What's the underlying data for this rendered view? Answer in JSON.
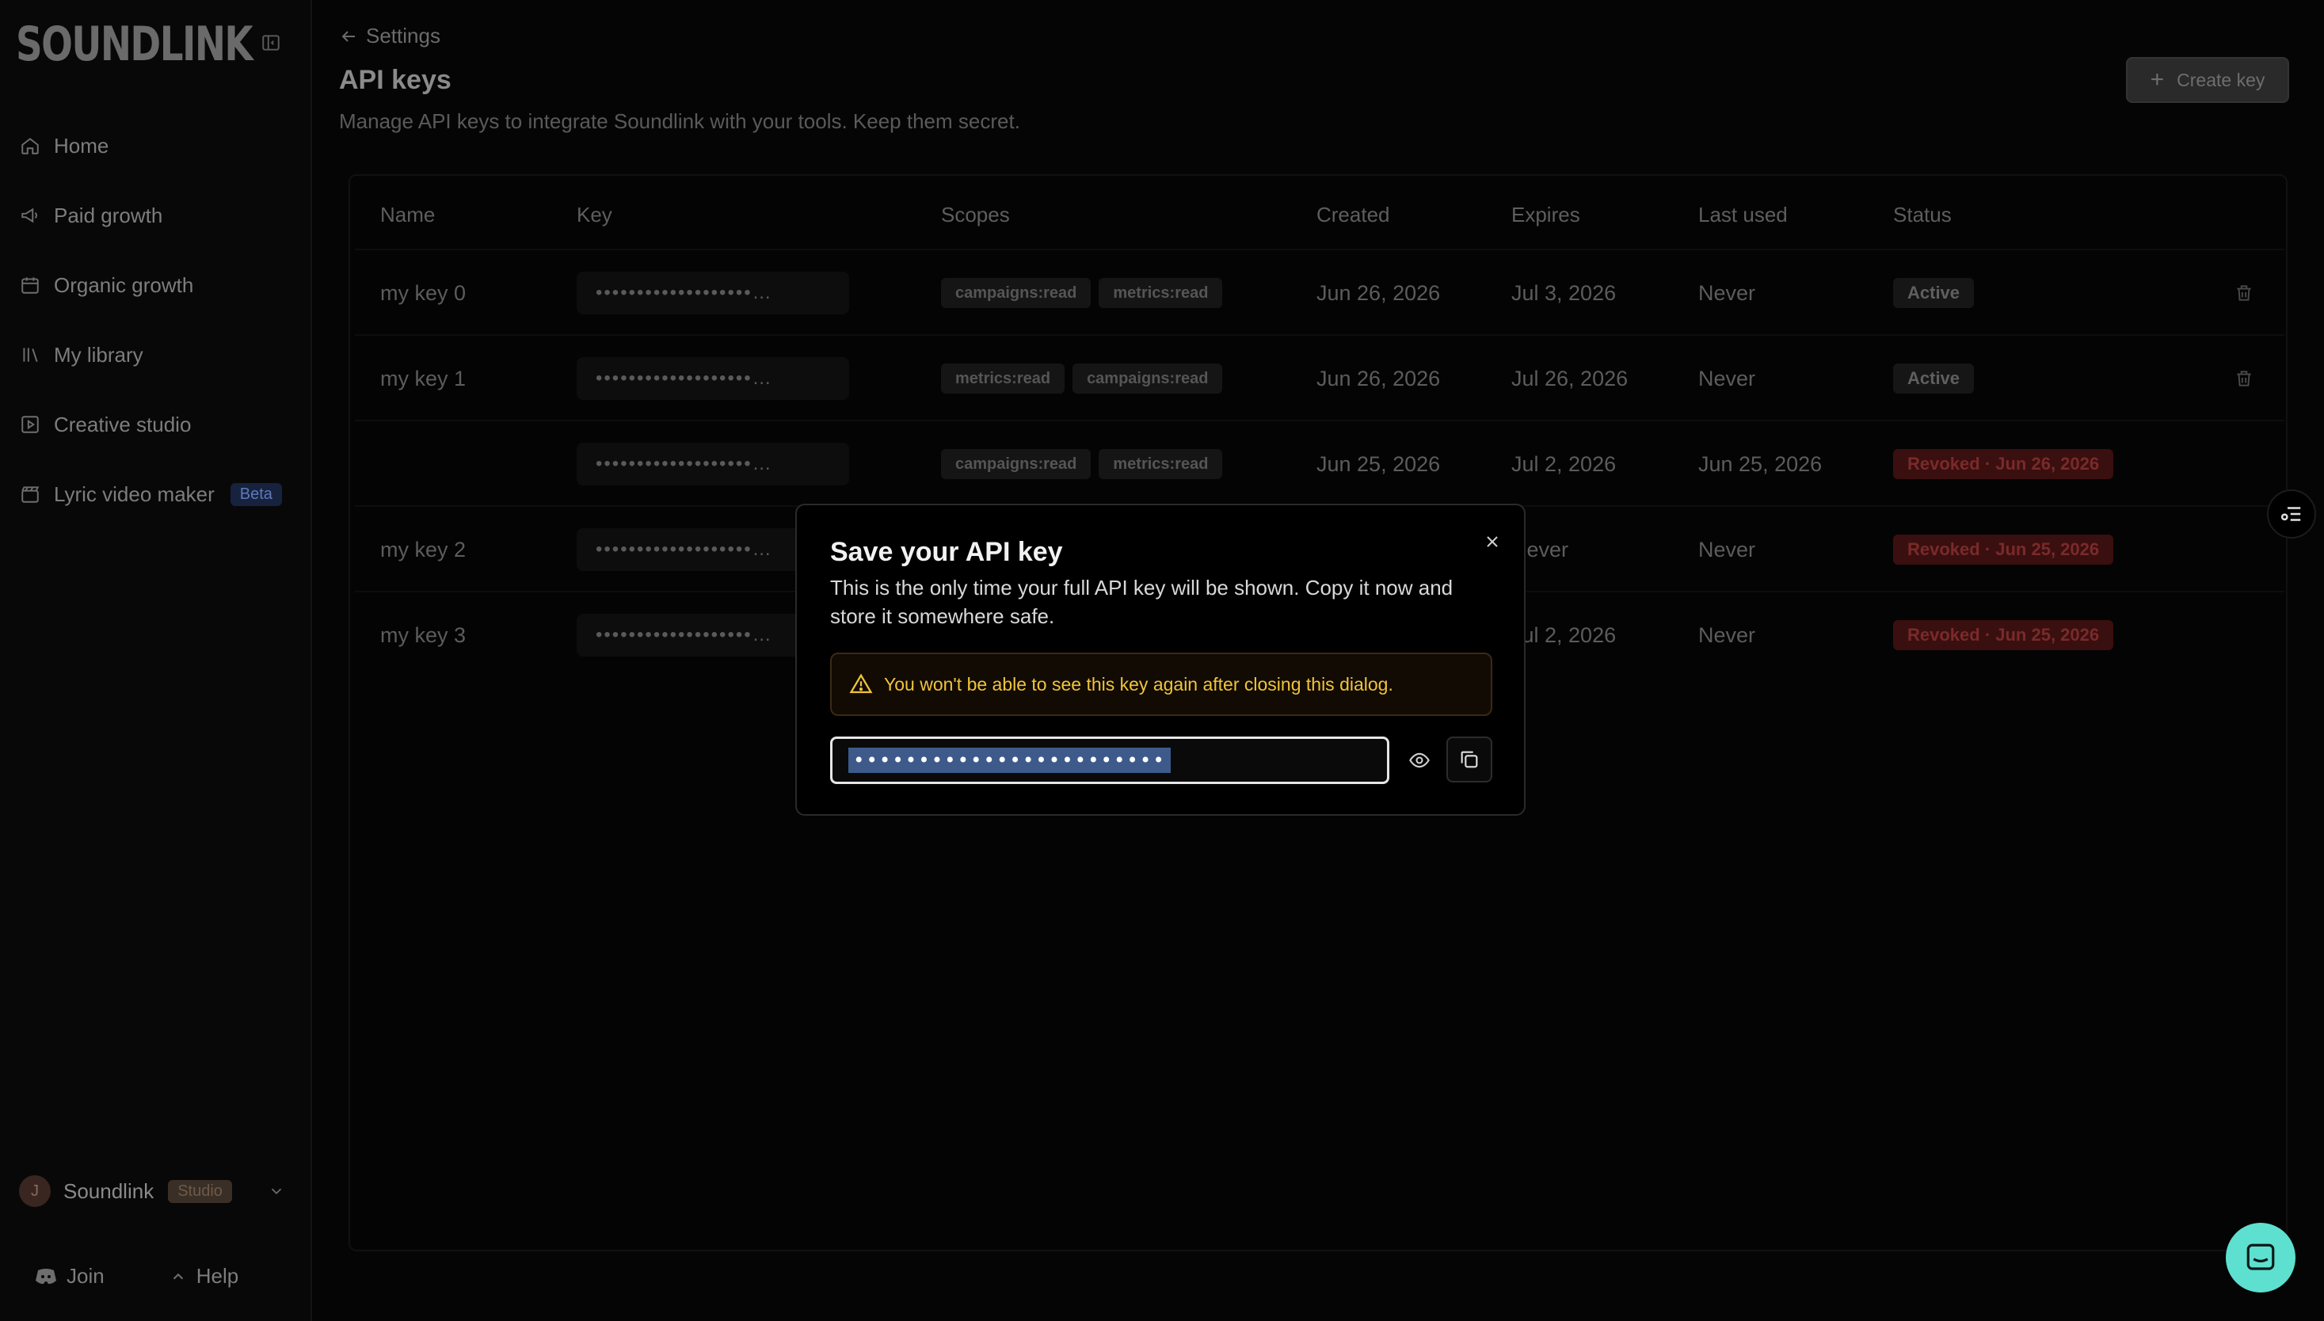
{
  "app": {
    "logo": "SOUNDLINK"
  },
  "sidebar": {
    "items": [
      {
        "label": "Home",
        "icon": "home-icon"
      },
      {
        "label": "Paid growth",
        "icon": "megaphone-icon"
      },
      {
        "label": "Organic growth",
        "icon": "calendar-icon"
      },
      {
        "label": "My library",
        "icon": "library-icon"
      },
      {
        "label": "Creative studio",
        "icon": "play-square-icon"
      },
      {
        "label": "Lyric video maker",
        "icon": "clapperboard-icon",
        "badge": "Beta"
      }
    ],
    "account": {
      "initial": "J",
      "name": "Soundlink",
      "plan": "Studio"
    },
    "footer": {
      "join": "Join",
      "help": "Help"
    }
  },
  "page": {
    "back": "Settings",
    "title": "API keys",
    "description": "Manage API keys to integrate Soundlink with your tools. Keep them secret.",
    "create_button": "Create key"
  },
  "table": {
    "headers": [
      "Name",
      "Key",
      "Scopes",
      "Created",
      "Expires",
      "Last used",
      "Status"
    ],
    "rows": [
      {
        "name": "my key 0",
        "key": "•••••••••••••••••••…",
        "scopes": [
          "campaigns:read",
          "metrics:read"
        ],
        "created": "Jun 26, 2026",
        "expires": "Jul 3, 2026",
        "last_used": "Never",
        "status": "Active",
        "status_type": "active",
        "deletable": true
      },
      {
        "name": "my key 1",
        "key": "•••••••••••••••••••…",
        "scopes": [
          "metrics:read",
          "campaigns:read"
        ],
        "created": "Jun 26, 2026",
        "expires": "Jul 26, 2026",
        "last_used": "Never",
        "status": "Active",
        "status_type": "active",
        "deletable": true
      },
      {
        "name": "",
        "key": "•••••••••••••••••••…",
        "scopes": [
          "campaigns:read",
          "metrics:read"
        ],
        "created": "Jun 25, 2026",
        "expires": "Jul 2, 2026",
        "last_used": "Jun 25, 2026",
        "status": "Revoked · Jun 26, 2026",
        "status_type": "revoked",
        "deletable": false
      },
      {
        "name": "my key 2",
        "key": "•••••••••••••••••••…",
        "scopes": [],
        "created": "",
        "expires": "Never",
        "last_used": "Never",
        "status": "Revoked · Jun 25, 2026",
        "status_type": "revoked",
        "deletable": false
      },
      {
        "name": "my key 3",
        "key": "•••••••••••••••••••…",
        "scopes": [],
        "created": "",
        "expires": "Jul 2, 2026",
        "last_used": "Never",
        "status": "Revoked · Jun 25, 2026",
        "status_type": "revoked",
        "deletable": false
      }
    ]
  },
  "dialog": {
    "title": "Save your API key",
    "description": "This is the only time your full API key will be shown. Copy it now and store it somewhere safe.",
    "warning": "You won't be able to see this key again after closing this dialog.",
    "key_value": "••••••••••••••••••••••••"
  },
  "colors": {
    "background": "#050505",
    "warning_text": "#f0c43a",
    "warning_border": "#3b2a12",
    "selection": "#3d5a8a",
    "chat_button": "#5de0cf",
    "revoked_badge": "#3a0f0f"
  }
}
